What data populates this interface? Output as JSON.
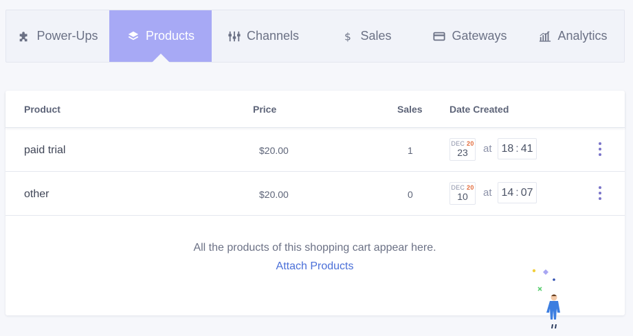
{
  "tabs": [
    {
      "label": "Power-Ups",
      "icon": "puzzle-icon",
      "active": false
    },
    {
      "label": "Products",
      "icon": "layers-icon",
      "active": true
    },
    {
      "label": "Channels",
      "icon": "channels-icon",
      "active": false
    },
    {
      "label": "Sales",
      "icon": "dollar-icon",
      "active": false
    },
    {
      "label": "Gateways",
      "icon": "credit-card-icon",
      "active": false
    },
    {
      "label": "Analytics",
      "icon": "bar-chart-icon",
      "active": false
    }
  ],
  "table": {
    "headers": {
      "product": "Product",
      "price": "Price",
      "sales": "Sales",
      "date": "Date Created"
    },
    "rows": [
      {
        "name": "paid trial",
        "price": "$20.00",
        "sales": "1",
        "month": "DEC",
        "year": "20",
        "day": "23",
        "at": "at",
        "hour": "18",
        "minute": "41"
      },
      {
        "name": "other",
        "price": "$20.00",
        "sales": "0",
        "month": "DEC",
        "year": "20",
        "day": "10",
        "at": "at",
        "hour": "14",
        "minute": "07"
      }
    ]
  },
  "empty": {
    "message": "All the products of this shopping cart appear here.",
    "link": "Attach Products"
  },
  "colors": {
    "active_tab": "#a7a9f5",
    "link": "#4a6fd8",
    "kebab": "#7a74c9",
    "year_accent": "#e26c3d"
  }
}
